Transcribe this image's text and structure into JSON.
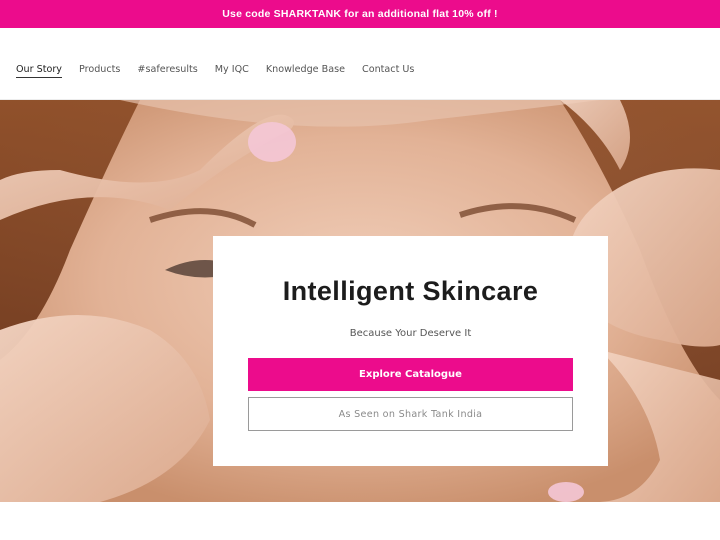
{
  "announcement": {
    "text": "Use code SHARKTANK for an additional flat 10% off !"
  },
  "nav": {
    "items": [
      {
        "label": "Our Story"
      },
      {
        "label": "Products"
      },
      {
        "label": "#saferesults"
      },
      {
        "label": "My IQC"
      },
      {
        "label": "Knowledge Base"
      },
      {
        "label": "Contact Us"
      }
    ],
    "active_index": 0
  },
  "hero": {
    "image_description_icon": "hero-face-image",
    "card": {
      "title": "Intelligent Skincare",
      "subtitle": "Because Your Deserve It",
      "primary_button": "Explore Catalogue",
      "secondary_button": "As Seen on Shark Tank India"
    }
  },
  "colors": {
    "brand_pink": "#ec0c8c",
    "text_dark": "#1c1c1c",
    "text_muted": "#555555"
  }
}
